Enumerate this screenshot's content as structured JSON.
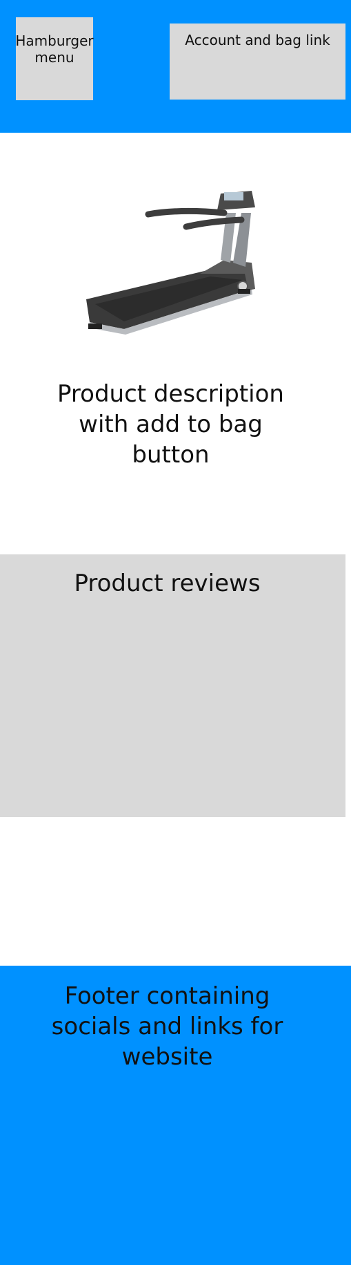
{
  "header": {
    "hamburger_label": "Hamburger menu",
    "account_label": "Account and bag link",
    "background_color": "#0091ff"
  },
  "product": {
    "image_icon": "treadmill-image",
    "description": "Product description with add to bag button"
  },
  "reviews": {
    "title": "Product reviews"
  },
  "footer": {
    "text": "Footer containing socials and links for website"
  },
  "colors": {
    "placeholder_gray": "#d9d9d9",
    "brand_blue": "#0091ff"
  }
}
